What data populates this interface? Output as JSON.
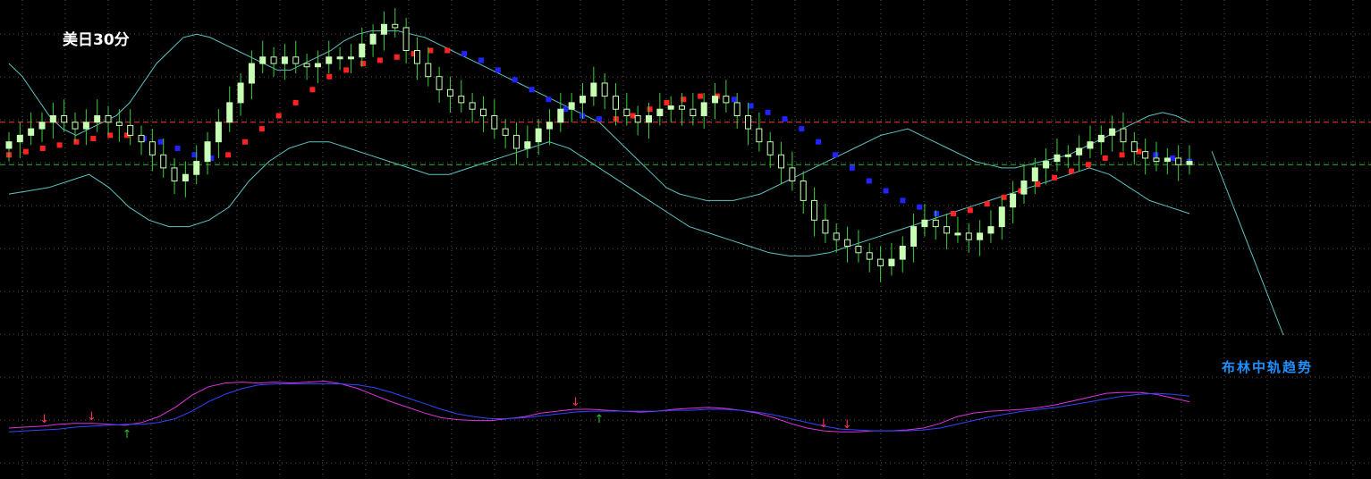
{
  "chart_data": {
    "type": "candlestick",
    "title": "美日30分",
    "annotation": "布林中轨趋势",
    "price_range": [
      0,
      100
    ],
    "oscillator_range": [
      0,
      100
    ],
    "grid": true,
    "colors": {
      "background": "#000000",
      "grid": "#555555",
      "candle": "#c8ffb4",
      "candle_wick": "#39d139",
      "bollinger": "#5fc3c3",
      "midline_up": "#ff2222",
      "midline_down": "#2222ff",
      "resistance": "#ff3b3b",
      "support": "#2eb82e",
      "osc_fast": "#dd33dd",
      "osc_slow": "#3344ff",
      "signal_down": "#ff3355",
      "signal_up": "#33bb33",
      "annotation": "#1e90ff"
    },
    "horizontal_levels": [
      {
        "name": "resistance",
        "y": 68
      },
      {
        "name": "support",
        "y": 55
      }
    ],
    "closes": [
      62,
      64,
      66,
      68,
      70,
      68,
      66,
      68,
      70,
      68,
      67,
      64,
      62,
      58,
      54,
      50,
      52,
      56,
      62,
      68,
      74,
      80,
      86,
      88,
      86,
      88,
      86,
      85,
      86,
      88,
      88,
      88,
      92,
      95,
      98,
      97,
      90,
      86,
      82,
      78,
      76,
      74,
      72,
      70,
      66,
      64,
      60,
      62,
      66,
      68,
      72,
      74,
      76,
      80,
      76,
      72,
      70,
      68,
      70,
      72,
      73,
      72,
      70,
      74,
      76,
      74,
      70,
      66,
      62,
      58,
      54,
      50,
      44,
      38,
      34,
      32,
      30,
      28,
      26,
      24,
      26,
      30,
      36,
      38,
      36,
      34,
      34,
      32,
      34,
      36,
      42,
      46,
      50,
      54,
      56,
      58,
      58,
      60,
      62,
      64,
      66,
      62,
      59,
      57,
      56,
      57,
      55,
      56
    ],
    "upper_band": [
      86,
      82,
      76,
      70,
      66,
      64,
      66,
      68,
      70,
      74,
      80,
      86,
      90,
      94,
      95,
      94,
      92,
      90,
      88,
      86,
      84,
      84,
      86,
      88,
      90,
      93,
      95,
      96,
      96,
      96,
      95,
      94,
      92,
      90,
      88,
      86,
      84,
      82,
      80,
      78,
      76,
      74,
      72,
      70,
      68,
      64,
      60,
      56,
      52,
      48,
      46,
      45,
      44,
      44,
      44,
      45,
      46,
      48,
      50,
      52,
      54,
      56,
      58,
      60,
      62,
      64,
      65,
      66,
      64,
      62,
      60,
      58,
      56,
      55,
      54,
      54,
      55,
      56,
      57,
      58,
      60,
      62,
      64,
      66,
      68,
      70,
      71,
      70,
      68
    ],
    "lower_band": [
      46,
      47,
      48,
      50,
      52,
      48,
      42,
      38,
      36,
      36,
      38,
      42,
      50,
      56,
      60,
      62,
      62,
      60,
      58,
      56,
      54,
      52,
      52,
      54,
      56,
      58,
      60,
      62,
      60,
      56,
      52,
      48,
      44,
      40,
      36,
      34,
      32,
      30,
      28,
      27,
      27,
      28,
      30,
      32,
      34,
      36,
      38,
      40,
      42,
      44,
      46,
      48,
      50,
      52,
      54,
      52,
      48,
      44,
      42,
      40
    ],
    "midline": [
      58,
      59,
      60,
      61,
      62,
      63,
      64,
      64,
      63,
      62,
      60,
      58,
      57,
      58,
      62,
      66,
      70,
      74,
      78,
      82,
      84,
      86,
      87,
      88,
      89,
      90,
      90,
      89,
      87,
      84,
      81,
      78,
      75,
      72,
      70,
      69,
      69,
      70,
      72,
      74,
      75,
      76,
      76,
      75,
      73,
      71,
      69,
      66,
      62,
      58,
      54,
      50,
      47,
      44,
      42,
      40,
      40,
      41,
      43,
      45,
      47,
      49,
      51,
      53,
      55,
      57,
      58,
      59,
      58,
      57,
      56
    ],
    "osc_fast": [
      20,
      21,
      22,
      24,
      25,
      25,
      24,
      23,
      26,
      32,
      42,
      55,
      64,
      68,
      69,
      68,
      69,
      68,
      69,
      70,
      67,
      62,
      55,
      48,
      42,
      36,
      31,
      29,
      28,
      28,
      30,
      32,
      36,
      38,
      40,
      40,
      39,
      38,
      37,
      38,
      40,
      41,
      42,
      41,
      39,
      36,
      31,
      25,
      20,
      17,
      16,
      16,
      17,
      17,
      18,
      20,
      25,
      32,
      36,
      38,
      39,
      40,
      42,
      45,
      49,
      53,
      57,
      58,
      58,
      56,
      52,
      48
    ],
    "osc_slow": [
      16,
      17,
      18,
      19,
      21,
      22,
      23,
      24,
      24,
      26,
      30,
      38,
      48,
      56,
      62,
      66,
      67,
      67,
      67,
      67,
      67,
      66,
      63,
      58,
      52,
      46,
      40,
      35,
      32,
      30,
      30,
      31,
      33,
      35,
      37,
      38,
      38,
      38,
      38,
      38,
      39,
      39,
      40,
      40,
      39,
      37,
      34,
      30,
      26,
      22,
      19,
      18,
      17,
      17,
      17,
      18,
      20,
      24,
      28,
      32,
      35,
      38,
      40,
      42,
      45,
      48,
      51,
      54,
      56,
      57,
      56,
      54
    ],
    "signals": [
      {
        "type": "down",
        "position": 0.03
      },
      {
        "type": "down",
        "position": 0.07
      },
      {
        "type": "up",
        "position": 0.1
      },
      {
        "type": "down",
        "position": 0.48
      },
      {
        "type": "up",
        "position": 0.5
      },
      {
        "type": "down",
        "position": 0.69
      },
      {
        "type": "down",
        "position": 0.71
      }
    ]
  }
}
